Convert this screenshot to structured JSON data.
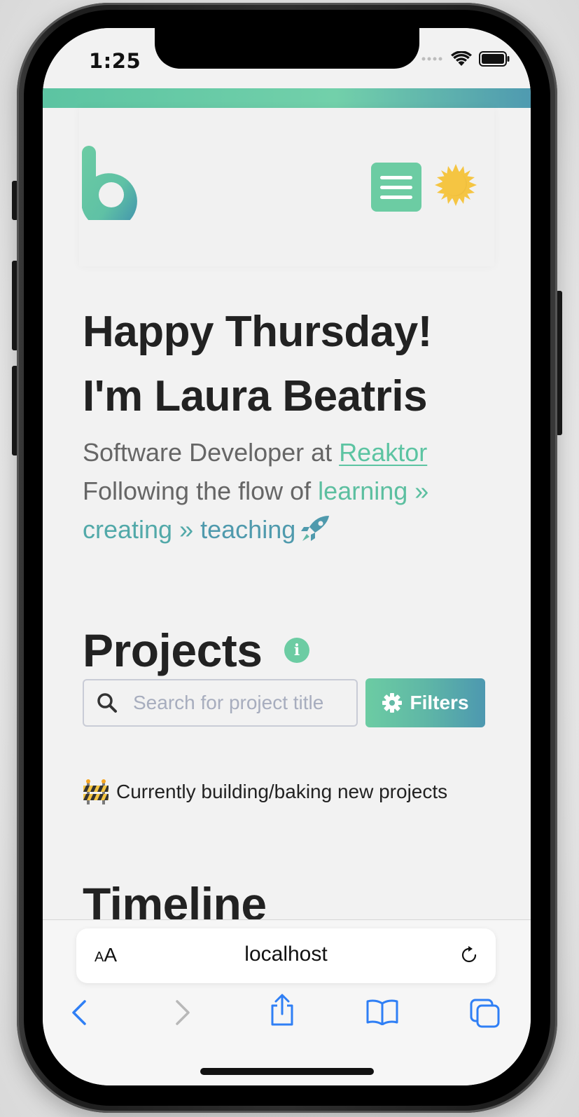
{
  "status_bar": {
    "time": "1:25"
  },
  "navbar": {
    "logo_letter": "b",
    "menu_icon": "hamburger-icon",
    "theme_icon": "sun-moon-icon"
  },
  "hero": {
    "greeting_line1": "Happy Thursday!",
    "greeting_line2": "I'm Laura Beatris",
    "subtitle_prefix": "Software Developer at ",
    "company_link": "Reaktor",
    "flow_prefix": "Following the flow of ",
    "flow_learning": "learning »",
    "flow_creating": "creating »",
    "flow_teaching": "teaching"
  },
  "projects": {
    "title": "Projects",
    "info_icon_glyph": "i",
    "search_placeholder": "Search for project title",
    "filters_label": "Filters",
    "building_emoji_icon": "construction-icon",
    "building_message": "Currently building/baking new projects"
  },
  "timeline": {
    "title": "Timeline"
  },
  "browser": {
    "aa_small": "A",
    "aa_big": "A",
    "url": "localhost"
  },
  "colors": {
    "accent": "#6ccca3",
    "accent_blue": "#4d98b0",
    "text_dark": "#222222",
    "text_muted": "#666666",
    "ios_blue": "#2f7ff5"
  }
}
